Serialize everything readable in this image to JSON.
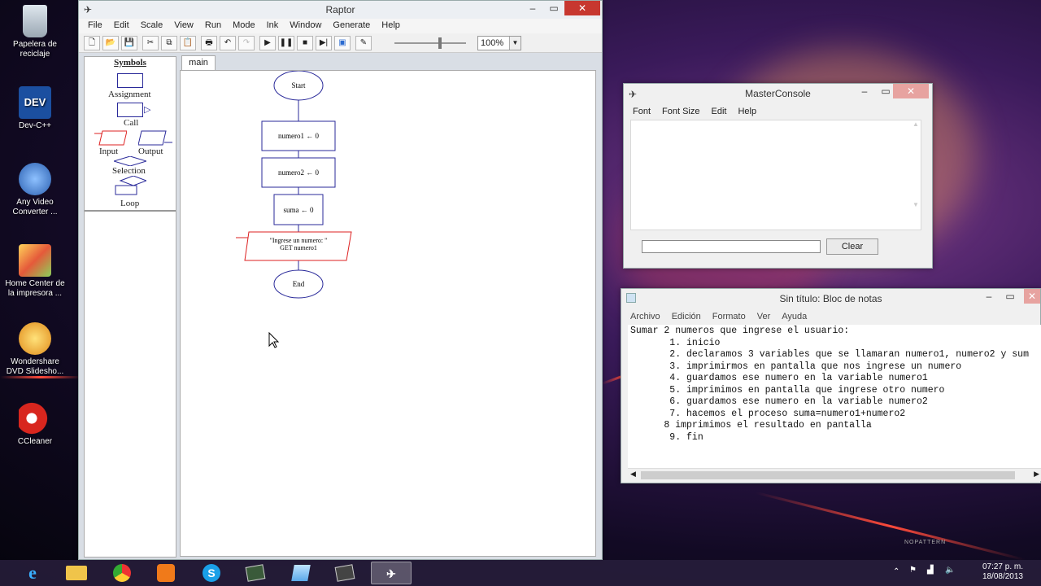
{
  "desktop": {
    "icons": [
      {
        "label": "Papelera de reciclaje",
        "icon": "recycle-bin-icon"
      },
      {
        "label": "Dev-C++",
        "icon": "devcpp-icon"
      },
      {
        "label": "Any Video Converter ...",
        "icon": "video-converter-icon"
      },
      {
        "label": "Home Center de la impresora ...",
        "icon": "printer-icon"
      },
      {
        "label": "Wondershare DVD Slidesho...",
        "icon": "dvd-slideshow-icon"
      },
      {
        "label": "CCleaner",
        "icon": "ccleaner-icon"
      }
    ],
    "watermark": "NOPATTERN"
  },
  "raptor": {
    "title": "Raptor",
    "menu": [
      "File",
      "Edit",
      "Scale",
      "View",
      "Run",
      "Mode",
      "Ink",
      "Window",
      "Generate",
      "Help"
    ],
    "zoom": "100%",
    "symbols_header": "Symbols",
    "symbols": {
      "assignment": "Assignment",
      "call": "Call",
      "input": "Input",
      "output": "Output",
      "selection": "Selection",
      "loop": "Loop"
    },
    "tab": "main",
    "flowchart": {
      "start": "Start",
      "assign1": "numero1 ← 0",
      "assign2": "numero2 ← 0",
      "assign3": "suma ← 0",
      "input_prompt": "\"Ingrese un numero: \"",
      "input_get": "GET numero1",
      "end": "End"
    }
  },
  "console": {
    "title": "MasterConsole",
    "menu": [
      "Font",
      "Font Size",
      "Edit",
      "Help"
    ],
    "input_value": "",
    "clear_label": "Clear"
  },
  "notepad": {
    "title": "Sin título: Bloc de notas",
    "menu": [
      "Archivo",
      "Edición",
      "Formato",
      "Ver",
      "Ayuda"
    ],
    "lines": [
      "Sumar 2 numeros que ingrese el usuario:",
      "",
      "       1. inicio",
      "       2. declaramos 3 variables que se llamaran numero1, numero2 y sum",
      "       3. imprimirmos en pantalla que nos ingrese un numero",
      "       4. guardamos ese numero en la variable numero1",
      "       5. imprimimos en pantalla que ingrese otro numero",
      "       6. guardamos ese numero en la variable numero2",
      "       7. hacemos el proceso suma=numero1+numero2",
      "      8 imprimimos el resultado en pantalla",
      "       9. fin"
    ]
  },
  "taskbar": {
    "items": [
      {
        "icon": "ie-icon",
        "glyph": "e"
      },
      {
        "icon": "file-explorer-icon",
        "glyph": ""
      },
      {
        "icon": "chrome-icon",
        "glyph": ""
      },
      {
        "icon": "media-player-icon",
        "glyph": ""
      },
      {
        "icon": "skype-icon",
        "glyph": "S"
      },
      {
        "icon": "app-icon",
        "glyph": ""
      },
      {
        "icon": "notepad-icon",
        "glyph": ""
      },
      {
        "icon": "app-icon-2",
        "glyph": ""
      },
      {
        "icon": "raptor-icon",
        "glyph": ""
      }
    ],
    "time": "07:27 p. m.",
    "date": "18/08/2013"
  }
}
